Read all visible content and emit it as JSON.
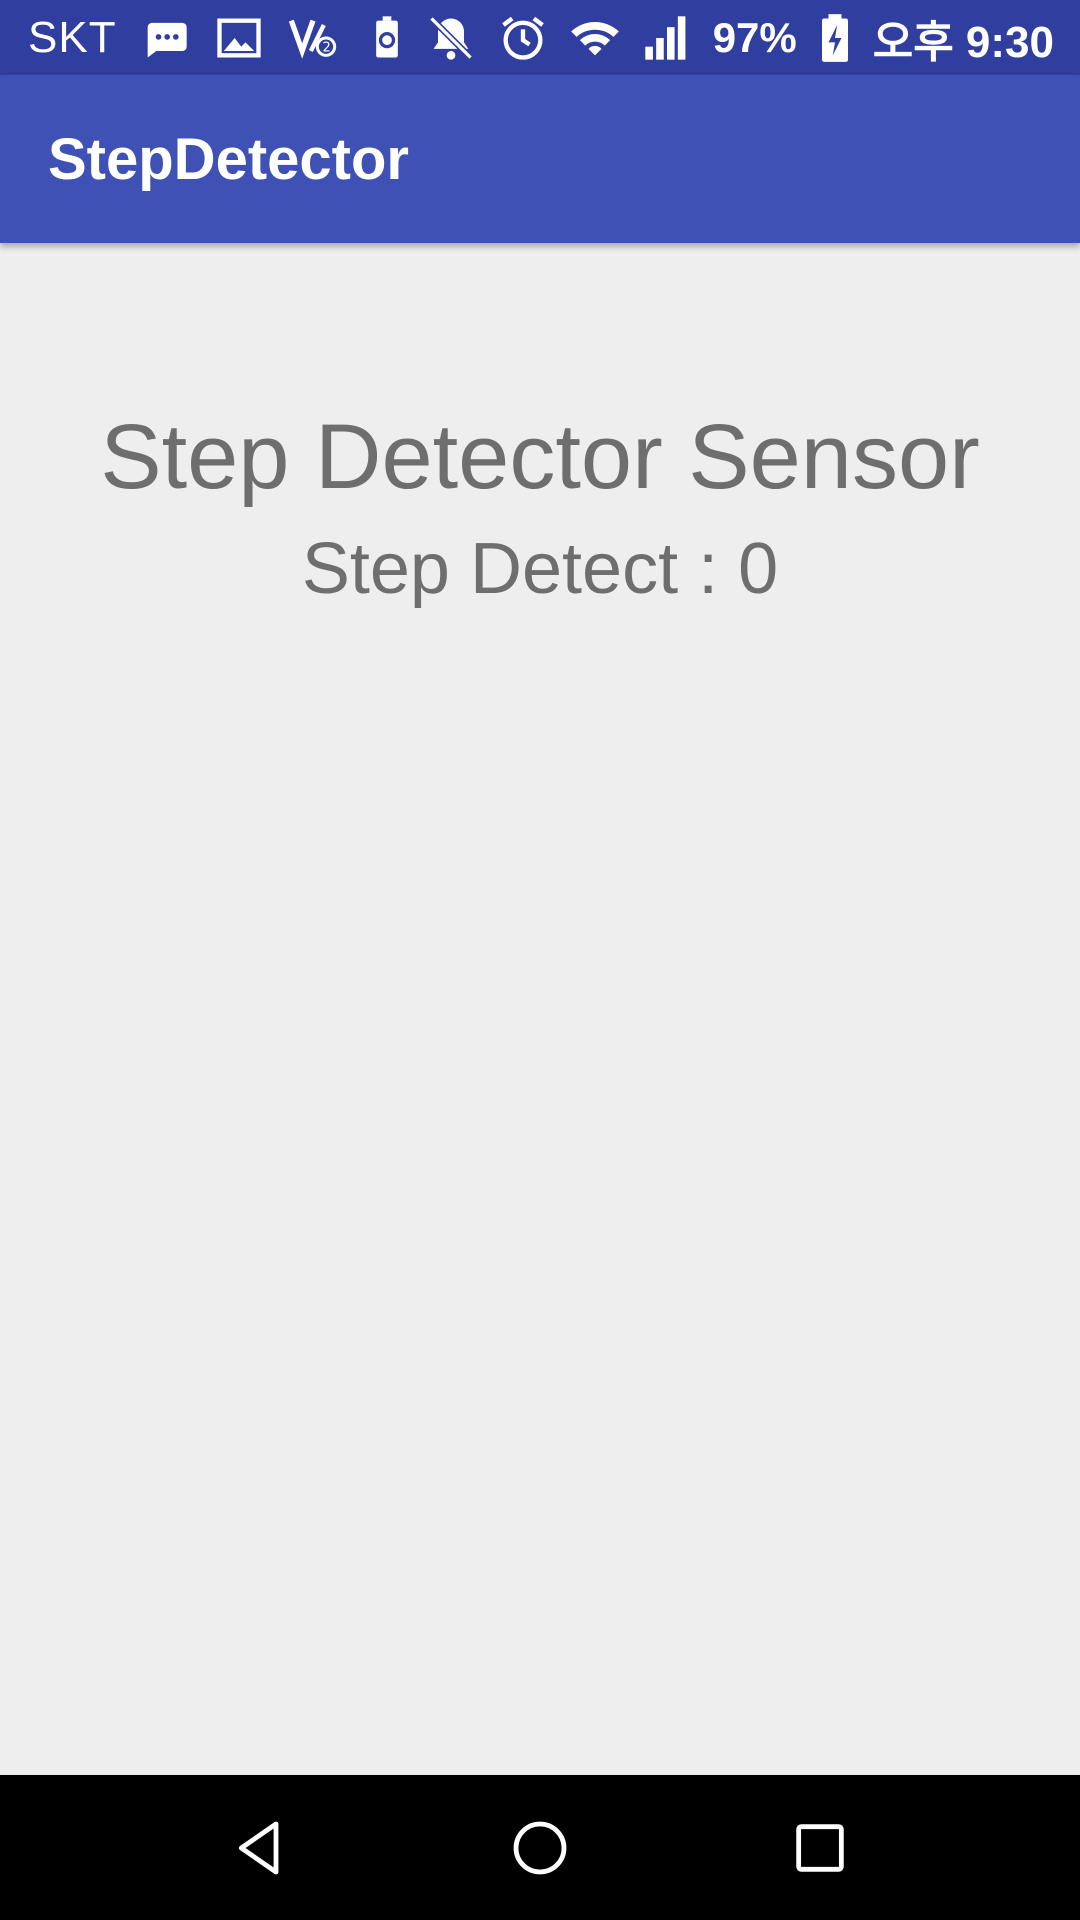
{
  "status_bar": {
    "carrier": "SKT",
    "battery_percent": "97%",
    "time": "오후 9:30",
    "icons": [
      "messenger-icon",
      "gallery-icon",
      "volte-icon",
      "battery-saver-icon",
      "notifications-off-icon",
      "alarm-icon",
      "wifi-icon",
      "signal-icon",
      "battery-charging-icon"
    ]
  },
  "app_bar": {
    "title": "StepDetector"
  },
  "main": {
    "heading": "Step Detector Sensor",
    "step_label": "Step Detect : 0"
  },
  "nav_bar": {
    "buttons": [
      "back-icon",
      "home-icon",
      "recents-icon"
    ]
  },
  "colors": {
    "status_bar": "#303f9f",
    "app_bar": "#3f51b5",
    "background": "#eeeeee",
    "text": "#6e6e6e"
  }
}
